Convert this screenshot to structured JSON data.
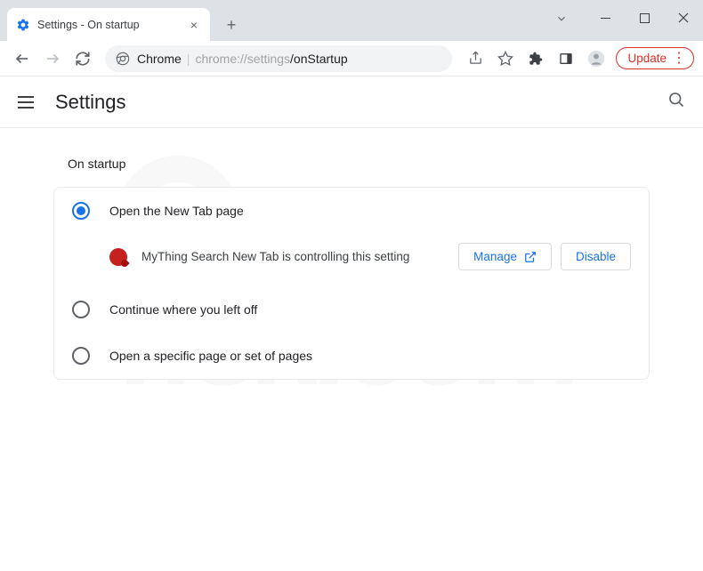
{
  "tab": {
    "title": "Settings - On startup"
  },
  "address": {
    "prefix": "Chrome",
    "url_host": "chrome://settings",
    "url_path": "/onStartup"
  },
  "update_button": "Update",
  "settings": {
    "title": "Settings",
    "section_title": "On startup",
    "options": [
      {
        "label": "Open the New Tab page",
        "checked": true
      },
      {
        "label": "Continue where you left off",
        "checked": false
      },
      {
        "label": "Open a specific page or set of pages",
        "checked": false
      }
    ],
    "extension_notice": "MyThing Search New Tab is controlling this setting",
    "manage_label": "Manage",
    "disable_label": "Disable"
  }
}
